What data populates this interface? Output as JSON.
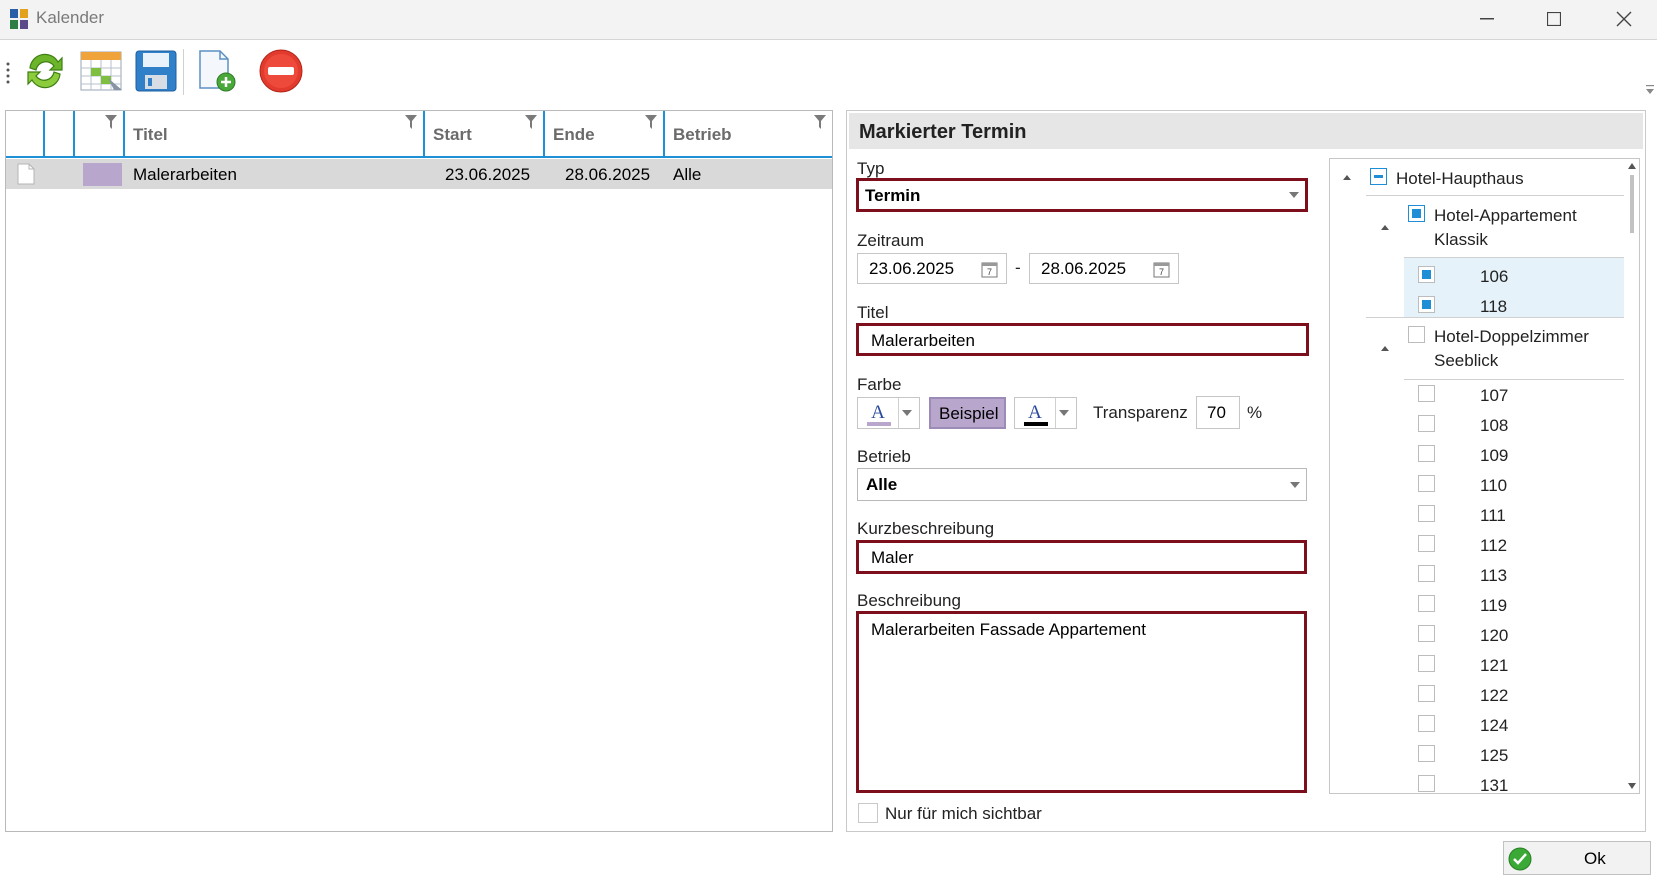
{
  "window": {
    "title": "Kalender",
    "controls": {
      "minimize": "minimize",
      "maximize": "maximize",
      "close": "close"
    }
  },
  "toolbar": {
    "buttons": [
      {
        "icon": "refresh-icon"
      },
      {
        "icon": "calendar-grid-icon"
      },
      {
        "icon": "save-icon"
      },
      {
        "icon": "new-document-icon"
      },
      {
        "icon": "delete-icon"
      }
    ]
  },
  "grid": {
    "columns": [
      "",
      "",
      "Titel",
      "Start",
      "Ende",
      "Betrieb"
    ],
    "rows": [
      {
        "color": "#b8a6cd",
        "title": "Malerarbeiten",
        "start": "23.06.2025",
        "end": "28.06.2025",
        "betrieb": "Alle"
      }
    ]
  },
  "detail": {
    "header": "Markierter Termin",
    "typ_label": "Typ",
    "typ_value": "Termin",
    "zeitraum_label": "Zeitraum",
    "zeitraum_from": "23.06.2025",
    "zeitraum_sep": "-",
    "zeitraum_to": "28.06.2025",
    "titel_label": "Titel",
    "titel_value": "Malerarbeiten",
    "farbe_label": "Farbe",
    "beispiel": "Beispiel",
    "transparenz_label": "Transparenz",
    "transparenz_value": "70",
    "percent": "%",
    "betrieb_label": "Betrieb",
    "betrieb_value": "Alle",
    "kurz_label": "Kurzbeschreibung",
    "kurz_value": "Maler",
    "beschreibung_label": "Beschreibung",
    "beschreibung_value": "Malerarbeiten Fassade Appartement",
    "nur_label": "Nur für mich sichtbar",
    "colors": {
      "accent": "#7d0f1d",
      "beispiel_bg": "#b8a6cd",
      "check": "#1e8fd6"
    }
  },
  "tree": {
    "root": "Hotel-Haupthaus",
    "group1_line1": "Hotel-Appartement",
    "group1_line2": "Klassik",
    "group1_items": [
      "106",
      "118"
    ],
    "group2_line1": "Hotel-Doppelzimmer",
    "group2_line2": "Seeblick",
    "group2_items": [
      "107",
      "108",
      "109",
      "110",
      "111",
      "112",
      "113",
      "119",
      "120",
      "121",
      "122",
      "124",
      "125",
      "131"
    ]
  },
  "footer": {
    "ok": "Ok"
  }
}
